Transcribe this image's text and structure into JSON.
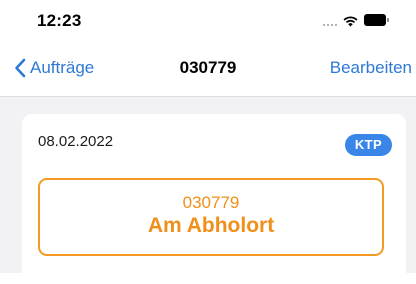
{
  "status_bar": {
    "time": "12:23",
    "icons": [
      "signal-icon",
      "wifi-icon",
      "battery-icon"
    ]
  },
  "nav": {
    "back_label": "Aufträge",
    "title": "030779",
    "edit_label": "Bearbeiten"
  },
  "order": {
    "date": "08.02.2022",
    "type_badge": "KTP",
    "number": "030779",
    "status": "Am Abholort"
  },
  "colors": {
    "accent_blue": "#2f79d6",
    "badge_blue": "#3a86e8",
    "status_orange": "#f08f1a",
    "background_gray": "#f2f2f5"
  }
}
